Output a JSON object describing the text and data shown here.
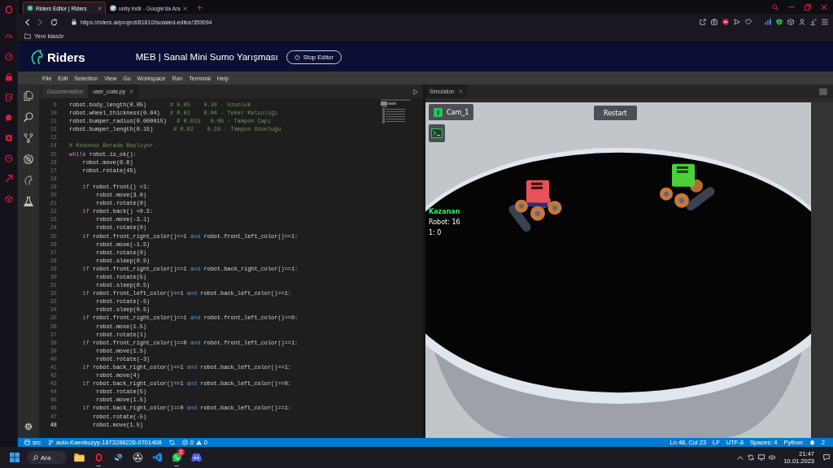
{
  "browser": {
    "tabs": [
      {
        "kind": "editor",
        "title": "Riders Editor | Riders",
        "selected": true
      },
      {
        "kind": "search",
        "title": "unity indir - Google'da Ara",
        "selected": false
      }
    ],
    "url": "https://riders.ai/project/81810/isolated-editor/359094",
    "bookmarks": [
      {
        "label": "Yeni klasör"
      }
    ]
  },
  "header": {
    "logo": "Riders",
    "title": "MEB | Sanal Mini Sumo Yarışması",
    "stop_button": "Stop Editor"
  },
  "menu": [
    "File",
    "Edit",
    "Selection",
    "View",
    "Go",
    "Workspace",
    "Run",
    "Terminal",
    "Help"
  ],
  "editor": {
    "tabs": [
      {
        "label": "Documentation",
        "selected": false,
        "closable": false
      },
      {
        "label": "user_code.py",
        "selected": true,
        "closable": true
      }
    ],
    "lines": [
      {
        "number": "9",
        "current": false,
        "segments": [
          {
            "kind": "code",
            "text": "robot.body_length(0.05)"
          },
          {
            "kind": "comment",
            "text": "       # 0.05    0.20 - Uzunluk"
          }
        ]
      },
      {
        "number": "10",
        "current": false,
        "segments": [
          {
            "kind": "code",
            "text": "robot.wheel_thickness(0.04)"
          },
          {
            "kind": "comment",
            "text": "   # 0.01    0.04 - Teker Kalınlığı"
          }
        ]
      },
      {
        "number": "11",
        "current": false,
        "segments": [
          {
            "kind": "code",
            "text": "robot.bumper_radius(0.000015)"
          },
          {
            "kind": "comment",
            "text": "   # 0.015   0.05 - Tampon Çapı"
          }
        ]
      },
      {
        "number": "12",
        "current": false,
        "segments": [
          {
            "kind": "code",
            "text": "robot.bumper_length(0.15)"
          },
          {
            "kind": "comment",
            "text": "      # 0.02    0.10 - Tampon Uzunluğu"
          }
        ]
      },
      {
        "number": "13",
        "current": false
      },
      {
        "number": "14",
        "current": false,
        "segments": [
          {
            "kind": "comment",
            "text": "# Kodunuz Burada Başlıyor"
          }
        ]
      },
      {
        "number": "15",
        "current": false,
        "segments": [
          {
            "kind": "keyword",
            "text": "while"
          },
          {
            "kind": "code",
            "text": " robot.is_ok():"
          }
        ]
      },
      {
        "number": "16",
        "current": false,
        "segments": [
          {
            "kind": "code",
            "text": "    robot.move(0.6)"
          }
        ]
      },
      {
        "number": "17",
        "current": false,
        "segments": [
          {
            "kind": "code",
            "text": "    robot.rotate(45)"
          }
        ]
      },
      {
        "number": "18",
        "current": false
      },
      {
        "number": "19",
        "current": false,
        "segments": [
          {
            "kind": "keyword",
            "text": "    if"
          },
          {
            "kind": "code",
            "text": " robot.front() <1:"
          }
        ]
      },
      {
        "number": "20",
        "current": false,
        "segments": [
          {
            "kind": "code",
            "text": "        robot.move(3.0)"
          }
        ]
      },
      {
        "number": "21",
        "current": false,
        "segments": [
          {
            "kind": "code",
            "text": "        robot.rotate(0)"
          }
        ]
      },
      {
        "number": "22",
        "current": false,
        "segments": [
          {
            "kind": "keyword",
            "text": "    if"
          },
          {
            "kind": "code",
            "text": " robot.back() <0.5:"
          }
        ]
      },
      {
        "number": "23",
        "current": false,
        "segments": [
          {
            "kind": "code",
            "text": "        robot.move(-3.1)"
          }
        ]
      },
      {
        "number": "24",
        "current": false,
        "segments": [
          {
            "kind": "code",
            "text": "        robot.rotate(0)"
          }
        ]
      },
      {
        "number": "25",
        "current": false,
        "segments": [
          {
            "kind": "keyword",
            "text": "    if"
          },
          {
            "kind": "code",
            "text": " robot.front_right_color()==1 "
          },
          {
            "kind": "operator",
            "text": "and"
          },
          {
            "kind": "code",
            "text": " robot.front_left_color()==1:"
          }
        ]
      },
      {
        "number": "26",
        "current": false,
        "segments": [
          {
            "kind": "code",
            "text": "        robot.move(-1.5)"
          }
        ]
      },
      {
        "number": "27",
        "current": false,
        "segments": [
          {
            "kind": "code",
            "text": "        robot.rotate(0)"
          }
        ]
      },
      {
        "number": "28",
        "current": false,
        "segments": [
          {
            "kind": "code",
            "text": "        robot.sleep(0.5)"
          }
        ]
      },
      {
        "number": "29",
        "current": false,
        "segments": [
          {
            "kind": "keyword",
            "text": "    if"
          },
          {
            "kind": "code",
            "text": " robot.front_right_color()==1 "
          },
          {
            "kind": "operator",
            "text": "and"
          },
          {
            "kind": "code",
            "text": " robot.back_right_color()==1:"
          }
        ]
      },
      {
        "number": "30",
        "current": false,
        "segments": [
          {
            "kind": "code",
            "text": "        robot.rotate(5)"
          }
        ]
      },
      {
        "number": "31",
        "current": false,
        "segments": [
          {
            "kind": "code",
            "text": "        robot.sleep(0.5)"
          }
        ]
      },
      {
        "number": "32",
        "current": false,
        "segments": [
          {
            "kind": "keyword",
            "text": "    if"
          },
          {
            "kind": "code",
            "text": " robot.front_left_color()==1 "
          },
          {
            "kind": "operator",
            "text": "and"
          },
          {
            "kind": "code",
            "text": " robot.back_left_color()==1:"
          }
        ]
      },
      {
        "number": "33",
        "current": false,
        "segments": [
          {
            "kind": "code",
            "text": "        robot.rotate(-5)"
          }
        ]
      },
      {
        "number": "34",
        "current": false,
        "segments": [
          {
            "kind": "code",
            "text": "        robot.sleep(0.5)"
          }
        ]
      },
      {
        "number": "35",
        "current": false,
        "segments": [
          {
            "kind": "keyword",
            "text": "    if"
          },
          {
            "kind": "code",
            "text": " robot.front_right_color()==1 "
          },
          {
            "kind": "operator",
            "text": "and"
          },
          {
            "kind": "code",
            "text": " robot.front_left_color()==0:"
          }
        ]
      },
      {
        "number": "36",
        "current": false,
        "segments": [
          {
            "kind": "code",
            "text": "        robot.move(1.5)"
          }
        ]
      },
      {
        "number": "37",
        "current": false,
        "segments": [
          {
            "kind": "code",
            "text": "        robot.rotate(1)"
          }
        ]
      },
      {
        "number": "38",
        "current": false,
        "segments": [
          {
            "kind": "keyword",
            "text": "    if"
          },
          {
            "kind": "code",
            "text": " robot.front_right_color()==0 "
          },
          {
            "kind": "operator",
            "text": "and"
          },
          {
            "kind": "code",
            "text": " robot.front_left_color()==1:"
          }
        ]
      },
      {
        "number": "39",
        "current": false,
        "segments": [
          {
            "kind": "code",
            "text": "        robot.move(1.5)"
          }
        ]
      },
      {
        "number": "40",
        "current": false,
        "segments": [
          {
            "kind": "code",
            "text": "        robot.rotate(-3)"
          }
        ]
      },
      {
        "number": "41",
        "current": false,
        "segments": [
          {
            "kind": "keyword",
            "text": "    if"
          },
          {
            "kind": "code",
            "text": " robot.back_right_color()==1 "
          },
          {
            "kind": "operator",
            "text": "and"
          },
          {
            "kind": "code",
            "text": " robot.back_left_color()==1:"
          }
        ]
      },
      {
        "number": "42",
        "current": false,
        "segments": [
          {
            "kind": "code",
            "text": "        robot.move(4)"
          }
        ]
      },
      {
        "number": "43",
        "current": false,
        "segments": [
          {
            "kind": "keyword",
            "text": "    if"
          },
          {
            "kind": "code",
            "text": " robot.back_right_color()==1 "
          },
          {
            "kind": "operator",
            "text": "and"
          },
          {
            "kind": "code",
            "text": " robot.back_left_color()==0:"
          }
        ]
      },
      {
        "number": "44",
        "current": false,
        "segments": [
          {
            "kind": "code",
            "text": "        robot.rotate(5)"
          }
        ]
      },
      {
        "number": "45",
        "current": false,
        "segments": [
          {
            "kind": "code",
            "text": "        robot.move(1.5)"
          }
        ]
      },
      {
        "number": "46",
        "current": false,
        "segments": [
          {
            "kind": "keyword",
            "text": "    if"
          },
          {
            "kind": "code",
            "text": " robot.back_right_color()==0 "
          },
          {
            "kind": "operator",
            "text": "and"
          },
          {
            "kind": "code",
            "text": " robot.back_left_color()==1:"
          }
        ]
      },
      {
        "number": "47",
        "current": false,
        "segments": [
          {
            "kind": "code",
            "text": "       robot.rotate(-5)"
          }
        ]
      },
      {
        "number": "48",
        "current": true,
        "segments": [
          {
            "kind": "code",
            "text": "       robot.move(1.5)"
          }
        ]
      }
    ]
  },
  "simulation": {
    "tabs": [
      {
        "label": "Simulation",
        "selected": true
      }
    ],
    "camera_button": "Cam_1",
    "restart_button": "Restart",
    "scoreboard": {
      "title": "Kazanan",
      "lines": [
        "Robot: 16",
        "1: 0"
      ]
    }
  },
  "status_bar": {
    "root": "src",
    "branch": "auto-Kaenkuzyy-1673288226-0701408",
    "errors": "0",
    "warnings": "0",
    "items": [
      "Ln 48, Col 23",
      "LF",
      "UTF-8",
      "Spaces: 4",
      "Python"
    ],
    "notifications": "2"
  },
  "taskbar": {
    "search": {
      "placeholder": "Ara"
    },
    "apps": [
      {
        "kind": "folder",
        "running": false
      },
      {
        "kind": "ring",
        "running": true
      },
      {
        "kind": "knob",
        "running": false
      },
      {
        "kind": "aperture",
        "running": false
      },
      {
        "kind": "ribbon",
        "running": false
      },
      {
        "kind": "chat",
        "running": true,
        "badge": "2"
      },
      {
        "kind": "gamepad",
        "running": false
      }
    ],
    "time": "21:47",
    "date": "10.01.2023"
  }
}
